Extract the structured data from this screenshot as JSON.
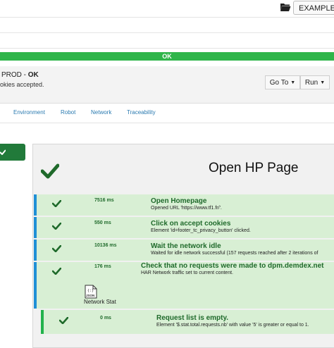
{
  "toolbar": {
    "folder_icon": "folder-open-icon",
    "examples_label": "EXAMPLES"
  },
  "status_bar": {
    "label": "OK",
    "color": "#2fb54a"
  },
  "header": {
    "env_prefix": "PROD - ",
    "env_status": "OK",
    "subtitle": "okies accepted.",
    "goto_label": "Go To",
    "run_label": "Run"
  },
  "tabs": [
    {
      "label": "Environment"
    },
    {
      "label": "Robot"
    },
    {
      "label": "Network"
    },
    {
      "label": "Traceability"
    }
  ],
  "page": {
    "title": "Open HP Page",
    "status_icon": "check-icon"
  },
  "steps": [
    {
      "time": "7516 ms",
      "title": "Open Homepage",
      "detail": "Opened URL 'https://www.tf1.fr/'."
    },
    {
      "time": "550 ms",
      "title": "Click on accept cookies",
      "detail": "Element 'id=footer_tc_privacy_button' clicked."
    },
    {
      "time": "10136 ms",
      "title": "Wait the network idle",
      "detail": "Waited for idle network successful (157 requests reached after 2 iterations of"
    },
    {
      "time": "176 ms",
      "title": "Check that no requests were made to dpm.demdex.net",
      "detail": "HAR Network traffic set to current content."
    },
    {
      "time": "0 ms",
      "title": "Request list is empty.",
      "detail": "Element '$.stat.total.requests.nb' with value '5' is greater or equal to 1."
    }
  ],
  "attachment": {
    "icon": "json-file-icon",
    "icon_text": "JSON",
    "label": "Network Stat"
  },
  "colors": {
    "accent_blue": "#1f8fd6",
    "success_green": "#22b24c",
    "dark_green": "#217a3a",
    "step_bg": "#d8efd4"
  }
}
